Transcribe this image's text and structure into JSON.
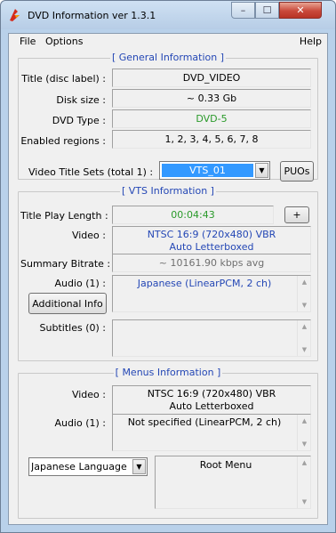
{
  "window": {
    "title": "DVD Information ver 1.3.1",
    "min_glyph": "–",
    "max_glyph": "☐",
    "close_glyph": "✕",
    "accent": "#3399ff"
  },
  "menu": {
    "file": "File",
    "options": "Options",
    "help": "Help"
  },
  "general": {
    "title": "[ General Information ]",
    "title_label": "Title (disc label) :",
    "title_value": "DVD_VIDEO",
    "disk_size_label": "Disk size :",
    "disk_size_value": "~ 0.33 Gb",
    "dvd_type_label": "DVD Type :",
    "dvd_type_value": "DVD-5",
    "regions_label": "Enabled regions :",
    "regions_value": "1, 2, 3, 4, 5, 6, 7, 8"
  },
  "vts_select": {
    "label": "Video Title Sets (total 1) :",
    "selected": "VTS_01",
    "puos_label": "PUOs"
  },
  "vts": {
    "title": "[ VTS Information ]",
    "play_length_label": "Title Play Length :",
    "play_length_value": "00:04:43",
    "plus_label": "+",
    "video_label": "Video :",
    "video_line1": "NTSC 16:9 (720x480) VBR",
    "video_line2": "Auto Letterboxed",
    "bitrate_label": "Summary Bitrate :",
    "bitrate_value": "~ 10161.90 kbps avg",
    "audio_label": "Audio (1) :",
    "audio_value": "Japanese (LinearPCM, 2 ch)",
    "additional_info_label": "Additional Info",
    "subtitles_label": "Subtitles (0) :"
  },
  "menus": {
    "title": "[ Menus Information ]",
    "video_label": "Video :",
    "video_line1": "NTSC 16:9 (720x480) VBR",
    "video_line2": "Auto Letterboxed",
    "audio_label": "Audio (1) :",
    "audio_value": "Not specified (LinearPCM, 2 ch)",
    "language_unit": "Japanese Language Unit",
    "root_menu": "Root Menu"
  }
}
